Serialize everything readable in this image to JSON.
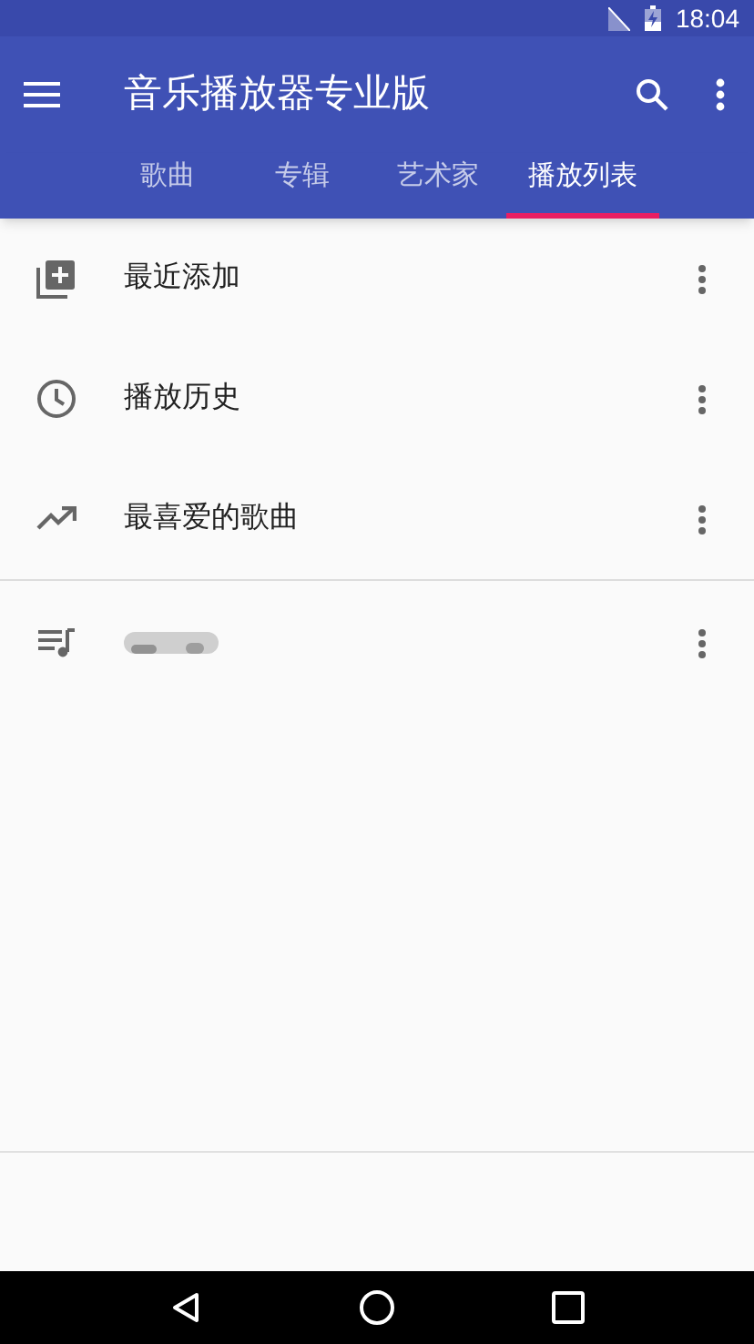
{
  "status_bar": {
    "time": "18:04"
  },
  "app_bar": {
    "title": "音乐播放器专业版"
  },
  "tabs": [
    {
      "label": "歌曲",
      "selected": false
    },
    {
      "label": "专辑",
      "selected": false
    },
    {
      "label": "艺术家",
      "selected": false
    },
    {
      "label": "播放列表",
      "selected": true
    }
  ],
  "smart_playlists": [
    {
      "kind": "recent",
      "label": "最近添加"
    },
    {
      "kind": "history",
      "label": "播放历史"
    },
    {
      "kind": "favorites",
      "label": "最喜爱的歌曲"
    }
  ],
  "user_playlists": [
    {
      "kind": "blurred"
    }
  ]
}
